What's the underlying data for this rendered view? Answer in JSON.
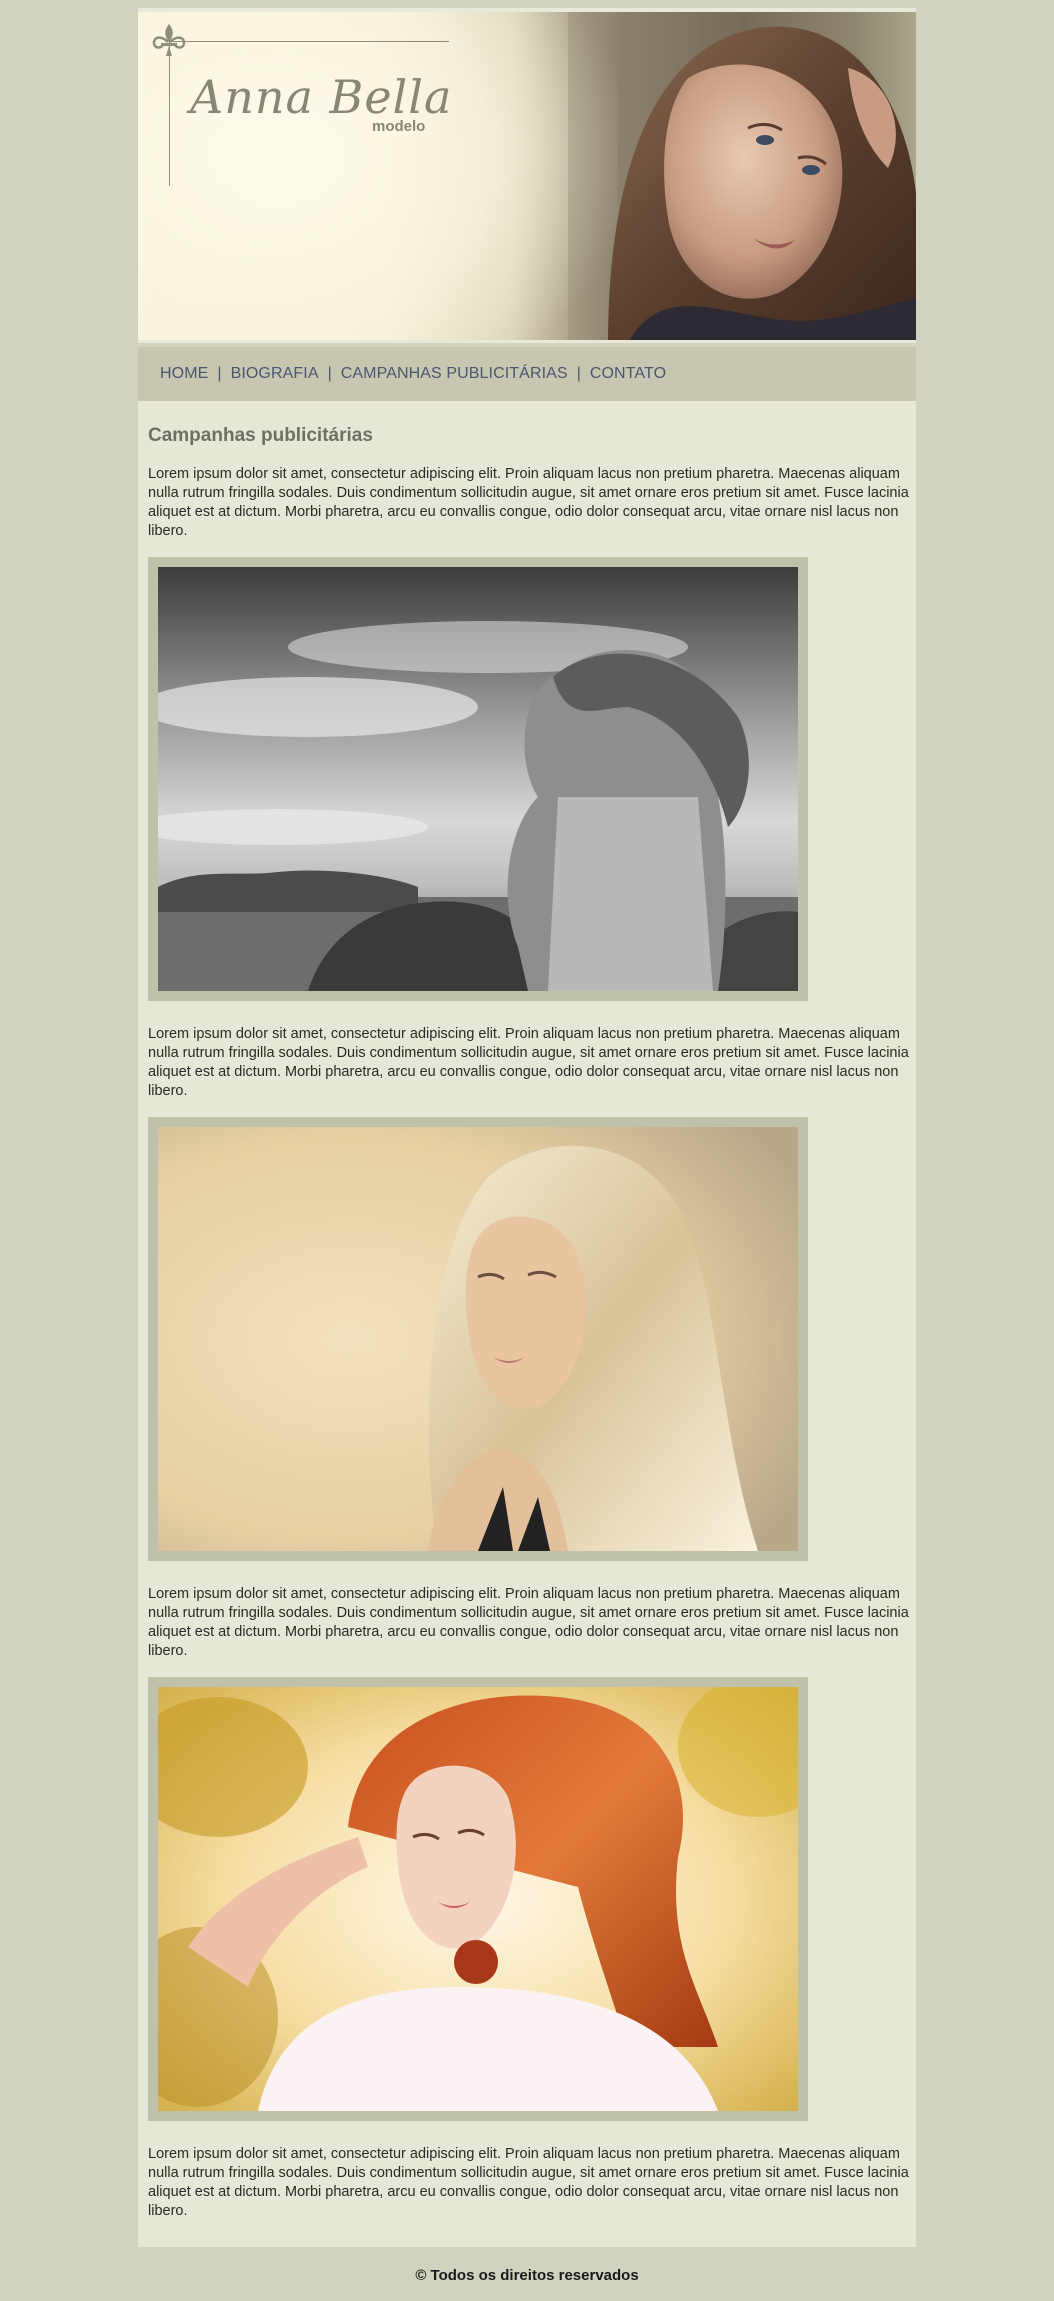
{
  "header": {
    "logo_name": "Anna Bella",
    "logo_subtitle": "modelo"
  },
  "nav": {
    "items": [
      {
        "label": "HOME"
      },
      {
        "label": "BIOGRAFIA"
      },
      {
        "label": "CAMPANHAS PUBLICITÁRIAS"
      },
      {
        "label": "CONTATO"
      }
    ],
    "separator": "|"
  },
  "main": {
    "title": "Campanhas publicitárias",
    "paragraphs": [
      "Lorem ipsum dolor sit amet, consectetur adipiscing elit. Proin aliquam lacus non pretium pharetra. Maecenas aliquam nulla rutrum fringilla sodales. Duis condimentum sollicitudin augue, sit amet ornare eros pretium sit amet. Fusce lacinia aliquet est at dictum. Morbi pharetra, arcu eu convallis congue, odio dolor consequat arcu, vitae ornare nisl lacus non libero.",
      "Lorem ipsum dolor sit amet, consectetur adipiscing elit. Proin aliquam lacus non pretium pharetra. Maecenas aliquam nulla rutrum fringilla sodales. Duis condimentum sollicitudin augue, sit amet ornare eros pretium sit amet. Fusce lacinia aliquet est at dictum. Morbi pharetra, arcu eu convallis congue, odio dolor consequat arcu, vitae ornare nisl lacus non libero.",
      "Lorem ipsum dolor sit amet, consectetur adipiscing elit. Proin aliquam lacus non pretium pharetra. Maecenas aliquam nulla rutrum fringilla sodales. Duis condimentum sollicitudin augue, sit amet ornare eros pretium sit amet. Fusce lacinia aliquet est at dictum. Morbi pharetra, arcu eu convallis congue, odio dolor consequat arcu, vitae ornare nisl lacus non libero.",
      "Lorem ipsum dolor sit amet, consectetur adipiscing elit. Proin aliquam lacus non pretium pharetra. Maecenas aliquam nulla rutrum fringilla sodales. Duis condimentum sollicitudin augue, sit amet ornare eros pretium sit amet. Fusce lacinia aliquet est at dictum. Morbi pharetra, arcu eu convallis congue, odio dolor consequat arcu, vitae ornare nisl lacus non libero."
    ]
  },
  "footer": {
    "copyright": "© Todos os direitos reservados"
  },
  "colors": {
    "page_bg": "#d1d2bf",
    "content_bg": "#e7e7d8",
    "nav_bg": "#c6c6b1",
    "nav_text": "#4b5570",
    "photo_frame": "#c0c1ab"
  }
}
